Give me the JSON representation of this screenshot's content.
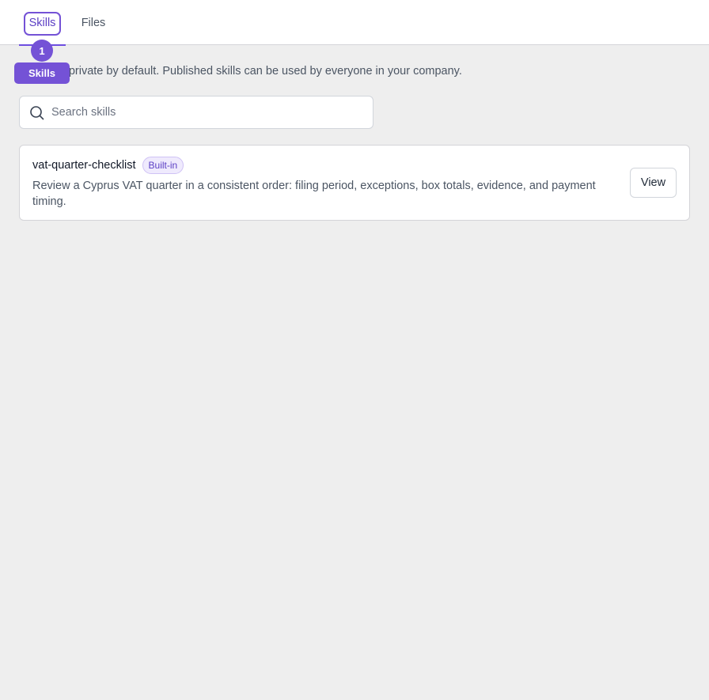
{
  "tabs": {
    "skills_label": "Skills",
    "files_label": "Files"
  },
  "marker": {
    "number": "1",
    "label": "Skills"
  },
  "intro_text": "Skills are private by default. Published skills can be used by everyone in your company.",
  "search": {
    "placeholder": "Search skills",
    "value": ""
  },
  "skills": [
    {
      "name": "vat-quarter-checklist",
      "badge": "Built-in",
      "description": "Review a Cyprus VAT quarter in a consistent order: filing period, exceptions, box totals, evidence, and payment timing.",
      "action_label": "View"
    }
  ],
  "colors": {
    "accent": "#7452d6",
    "background": "#eeeeee"
  },
  "icons": {
    "search": "search-icon"
  }
}
